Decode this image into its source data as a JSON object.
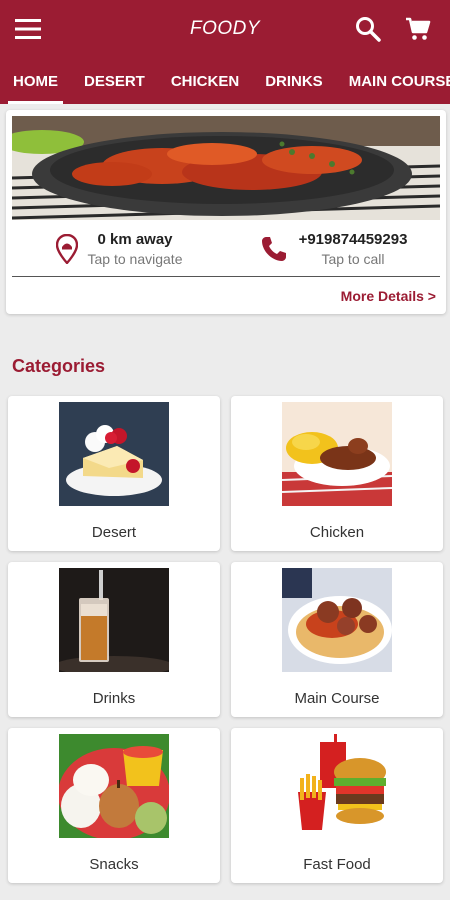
{
  "app": {
    "title": "FOODY"
  },
  "colors": {
    "primary": "#9b1c33",
    "background": "#ececec"
  },
  "header": {
    "menu_icon": "menu-icon",
    "search_icon": "search-icon",
    "cart_icon": "cart-icon"
  },
  "tabs": [
    {
      "label": "HOME",
      "active": true
    },
    {
      "label": "DESERT"
    },
    {
      "label": "CHICKEN"
    },
    {
      "label": "DRINKS"
    },
    {
      "label": "MAIN COURSE"
    }
  ],
  "restaurant": {
    "distance": "0 km away",
    "navigate_hint": "Tap to navigate",
    "phone": "+919874459293",
    "call_hint": "Tap to call",
    "more_link": "More Details >"
  },
  "categories": {
    "heading": "Categories",
    "items": [
      {
        "label": "Desert"
      },
      {
        "label": "Chicken"
      },
      {
        "label": "Drinks"
      },
      {
        "label": "Main Course"
      },
      {
        "label": "Snacks"
      },
      {
        "label": "Fast Food"
      }
    ]
  }
}
